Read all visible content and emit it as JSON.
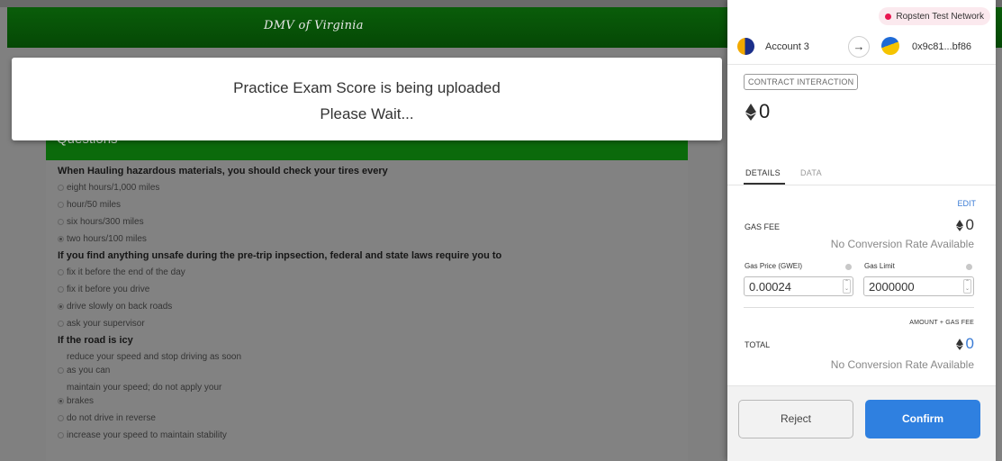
{
  "site": {
    "title": "DMV of Virginia",
    "questions_header": "Questions"
  },
  "modal": {
    "line1": "Practice Exam Score is being uploaded",
    "line2": "Please Wait..."
  },
  "questions": [
    {
      "text": "When Hauling hazardous materials, you should check your tires every",
      "options": [
        {
          "label": "eight hours/1,000 miles",
          "checked": false
        },
        {
          "label": "hour/50 miles",
          "checked": false
        },
        {
          "label": "six hours/300 miles",
          "checked": false
        },
        {
          "label": "two hours/100 miles",
          "checked": true
        }
      ]
    },
    {
      "text": "If you find anything unsafe during the pre-trip inpsection, federal and state laws require you to",
      "options": [
        {
          "label": "fix it before the end of the day",
          "checked": false
        },
        {
          "label": "fix it before you drive",
          "checked": false
        },
        {
          "label": "drive slowly on back roads",
          "checked": true
        },
        {
          "label": "ask your supervisor",
          "checked": false
        }
      ]
    },
    {
      "text": "If the road is icy",
      "options": [
        {
          "pre": "reduce your speed and stop driving as soon",
          "label": "as you can",
          "checked": false
        },
        {
          "pre": "maintain your speed; do not apply your",
          "label": "brakes",
          "checked": true
        },
        {
          "label": "do not drive in reverse",
          "checked": false
        },
        {
          "label": "increase your speed to maintain stability",
          "checked": false
        }
      ]
    }
  ],
  "wallet": {
    "network": "Ropsten Test Network",
    "network_dot_color": "#e91550",
    "account_name": "Account 3",
    "arrow_icon": "arrow-right-icon",
    "to_address": "0x9c81...bf86",
    "badge": "CONTRACT INTERACTION",
    "amount": "0",
    "tabs": {
      "details": "DETAILS",
      "data": "DATA"
    },
    "edit": "EDIT",
    "gas_fee_label": "GAS FEE",
    "gas_fee_value": "0",
    "no_conversion_1": "No Conversion Rate Available",
    "gas_price_label": "Gas Price (GWEI)",
    "gas_price_value": "0.00024",
    "gas_limit_label": "Gas Limit",
    "gas_limit_value": "2000000",
    "amount_gas_label": "AMOUNT + GAS FEE",
    "total_label": "TOTAL",
    "total_value": "0",
    "no_conversion_2": "No Conversion Rate Available",
    "reject_label": "Reject",
    "confirm_label": "Confirm",
    "confirm_color": "#2f80e0",
    "link_color": "#3a7bd5"
  }
}
